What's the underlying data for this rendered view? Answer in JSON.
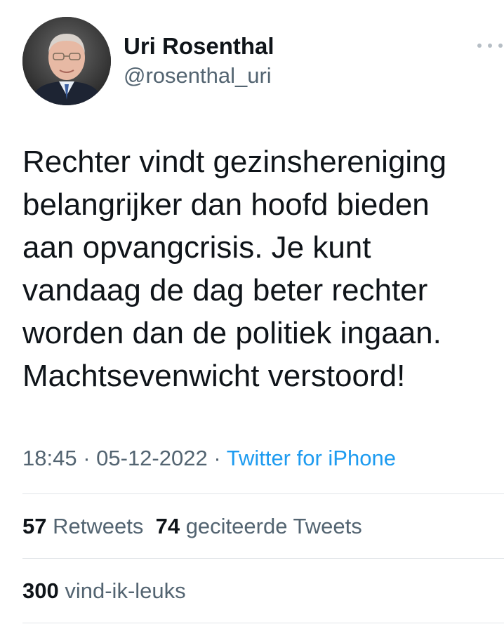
{
  "author": {
    "display_name": "Uri Rosenthal",
    "handle": "@rosenthal_uri"
  },
  "tweet": {
    "lines": [
      "Rechter vindt gezinshereniging",
      "belangrijker dan hoofd bieden",
      "aan opvangcrisis. Je kunt",
      "vandaag de dag beter rechter",
      "worden dan de politiek ingaan.",
      "Machtsevenwicht verstoord!"
    ],
    "time": "18:45",
    "separator": " · ",
    "date": "05-12-2022",
    "source": "Twitter for iPhone"
  },
  "stats": {
    "retweets_count": "57",
    "retweets_label": "Retweets",
    "quotes_count": "74",
    "quotes_label": "geciteerde Tweets",
    "likes_count": "300",
    "likes_label": "vind-ik-leuks"
  },
  "icons": {
    "more": "more-options-icon"
  },
  "colors": {
    "text": "#0f1419",
    "secondary": "#536471",
    "link": "#1d9bf0",
    "divider": "#e1e5e8"
  }
}
